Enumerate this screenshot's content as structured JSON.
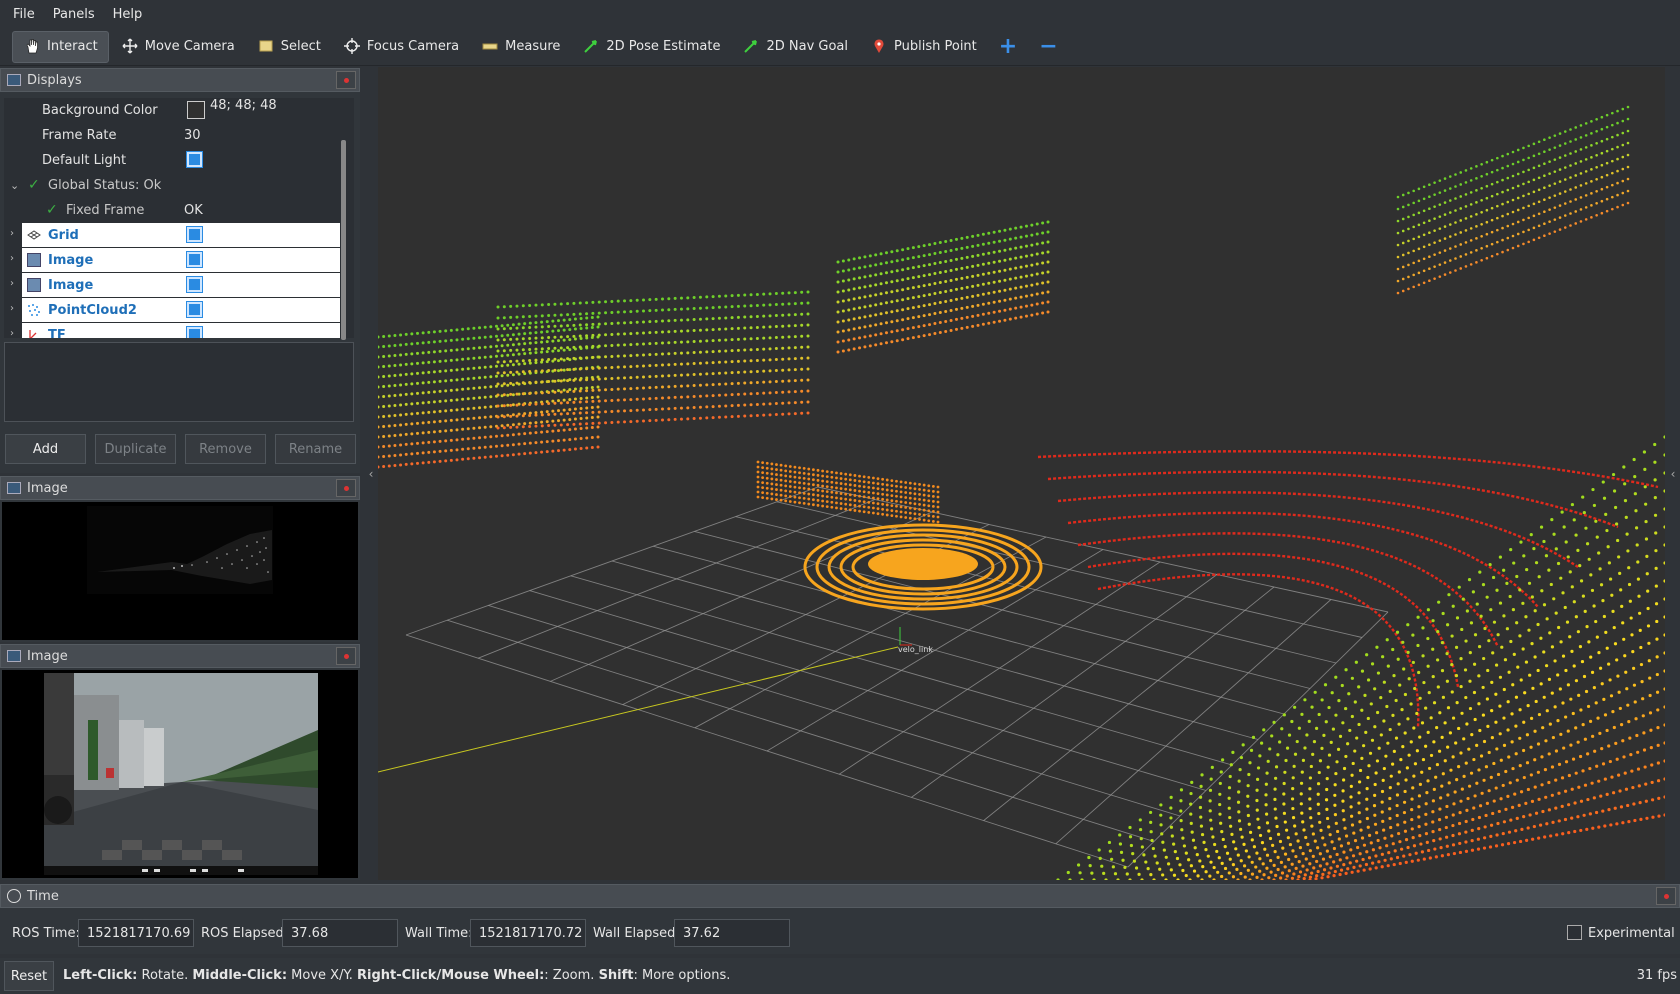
{
  "menu": [
    "File",
    "Panels",
    "Help"
  ],
  "toolbar": {
    "interact": "Interact",
    "move_camera": "Move Camera",
    "select": "Select",
    "focus_camera": "Focus Camera",
    "measure": "Measure",
    "pose_estimate": "2D Pose Estimate",
    "nav_goal": "2D Nav Goal",
    "publish_point": "Publish Point"
  },
  "displays": {
    "title": "Displays",
    "rows": [
      {
        "label": "Background Color",
        "value": "48; 48; 48"
      },
      {
        "label": "Frame Rate",
        "value": "30"
      },
      {
        "label": "Default Light",
        "value": ""
      },
      {
        "label": "Global Status: Ok",
        "value": ""
      },
      {
        "label": "Fixed Frame",
        "value": "OK"
      },
      {
        "label": "Grid",
        "value": ""
      },
      {
        "label": "Image",
        "value": ""
      },
      {
        "label": "Image",
        "value": ""
      },
      {
        "label": "PointCloud2",
        "value": ""
      },
      {
        "label": "TF",
        "value": ""
      }
    ],
    "buttons": {
      "add": "Add",
      "duplicate": "Duplicate",
      "remove": "Remove",
      "rename": "Rename"
    }
  },
  "image_panel_1": {
    "title": "Image"
  },
  "image_panel_2": {
    "title": "Image"
  },
  "viewport": {
    "frame_label": "velo_link"
  },
  "time": {
    "title": "Time",
    "ros_time_label": "ROS Time:",
    "ros_time": "1521817170.69",
    "ros_elapsed_label": "ROS Elapsed:",
    "ros_elapsed": "37.68",
    "wall_time_label": "Wall Time:",
    "wall_time": "1521817170.72",
    "wall_elapsed_label": "Wall Elapsed:",
    "wall_elapsed": "37.62",
    "experimental": "Experimental"
  },
  "status": {
    "reset": "Reset",
    "h1": "Left-Click:",
    "t1": " Rotate. ",
    "h2": "Middle-Click:",
    "t2": " Move X/Y. ",
    "h3": "Right-Click/Mouse Wheel:",
    "t3": ": Zoom. ",
    "h4": "Shift",
    "t4": ": More options.",
    "fps": "31 fps"
  },
  "colors": {
    "background": "#303030",
    "accent": "#2a8be2",
    "selected_text": "#1f6fb8"
  }
}
